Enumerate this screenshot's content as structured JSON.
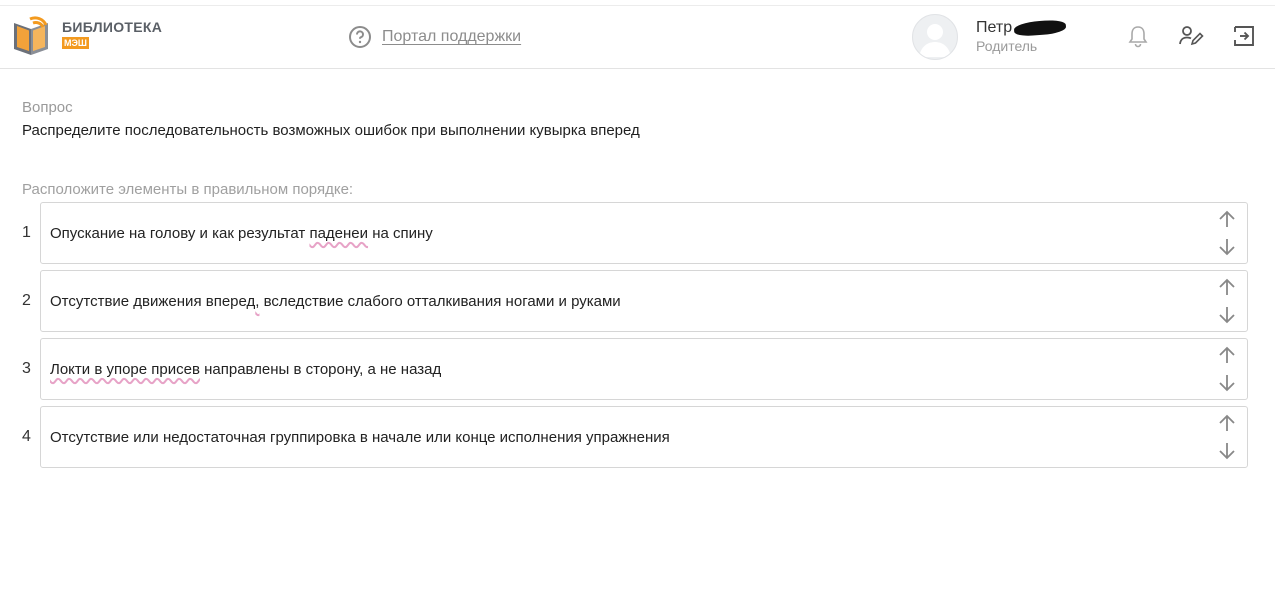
{
  "header": {
    "logo": {
      "title": "БИБЛИОТЕКА",
      "badge": "МЭШ"
    },
    "support": {
      "label": "Портал поддержки",
      "icon": "help-circle-icon"
    },
    "user": {
      "name": "Петр",
      "role": "Родитель"
    },
    "icons": [
      "bell-icon",
      "edit-user-icon",
      "logout-icon"
    ]
  },
  "question": {
    "label": "Вопрос",
    "text": "Распределите последовательность возможных ошибок при выполнении кувырка вперед"
  },
  "instruction": "Расположите элементы в правильном порядке:",
  "items": [
    {
      "number": "1",
      "parts": [
        "Опускание на голову и как результат ",
        "паденеи",
        " на спину"
      ]
    },
    {
      "number": "2",
      "parts": [
        "Отсутствие движения вперед",
        ",",
        " вследствие слабого отталкивания ногами и руками"
      ]
    },
    {
      "number": "3",
      "parts": [
        "",
        "Локти в упоре присев",
        " направлены в сторону, а не назад"
      ]
    },
    {
      "number": "4",
      "parts": [
        "Отсутствие или недостаточная группировка в начале или конце исполнения упражнения",
        "",
        ""
      ]
    }
  ],
  "colors": {
    "accent": "#f39a1f",
    "spellcheck": "#e7a3c7"
  }
}
